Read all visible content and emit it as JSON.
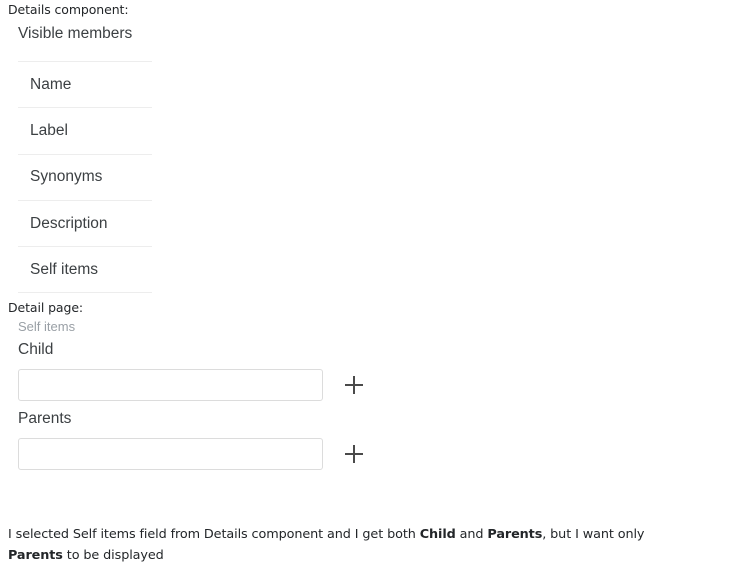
{
  "post": {
    "details_component_label": "Details component:",
    "detail_page_label": "Detail page:",
    "question_parts": {
      "p1": "I selected Self items field from Details component and I get both ",
      "b1": "Child",
      "p2": " and ",
      "b2": "Parents",
      "p3": ", but I want only ",
      "b3": "Parents",
      "p4": " to be displayed"
    }
  },
  "details_component": {
    "title": "Visible members",
    "members": [
      {
        "label": "Name"
      },
      {
        "label": "Label"
      },
      {
        "label": "Synonyms"
      },
      {
        "label": "Description"
      },
      {
        "label": "Self items"
      }
    ]
  },
  "detail_page": {
    "group_caption": "Self items",
    "fields": [
      {
        "label": "Child",
        "value": "",
        "placeholder": "",
        "add_icon": "plus-icon"
      },
      {
        "label": "Parents",
        "value": "",
        "placeholder": "",
        "add_icon": "plus-icon"
      }
    ]
  },
  "colors": {
    "text_primary": "#3c4043",
    "text_prose": "#232629",
    "text_muted": "#9aa0a6",
    "divider": "#ededed",
    "input_border": "#dcdcdc",
    "icon": "#4a4a4a",
    "background": "#ffffff"
  }
}
